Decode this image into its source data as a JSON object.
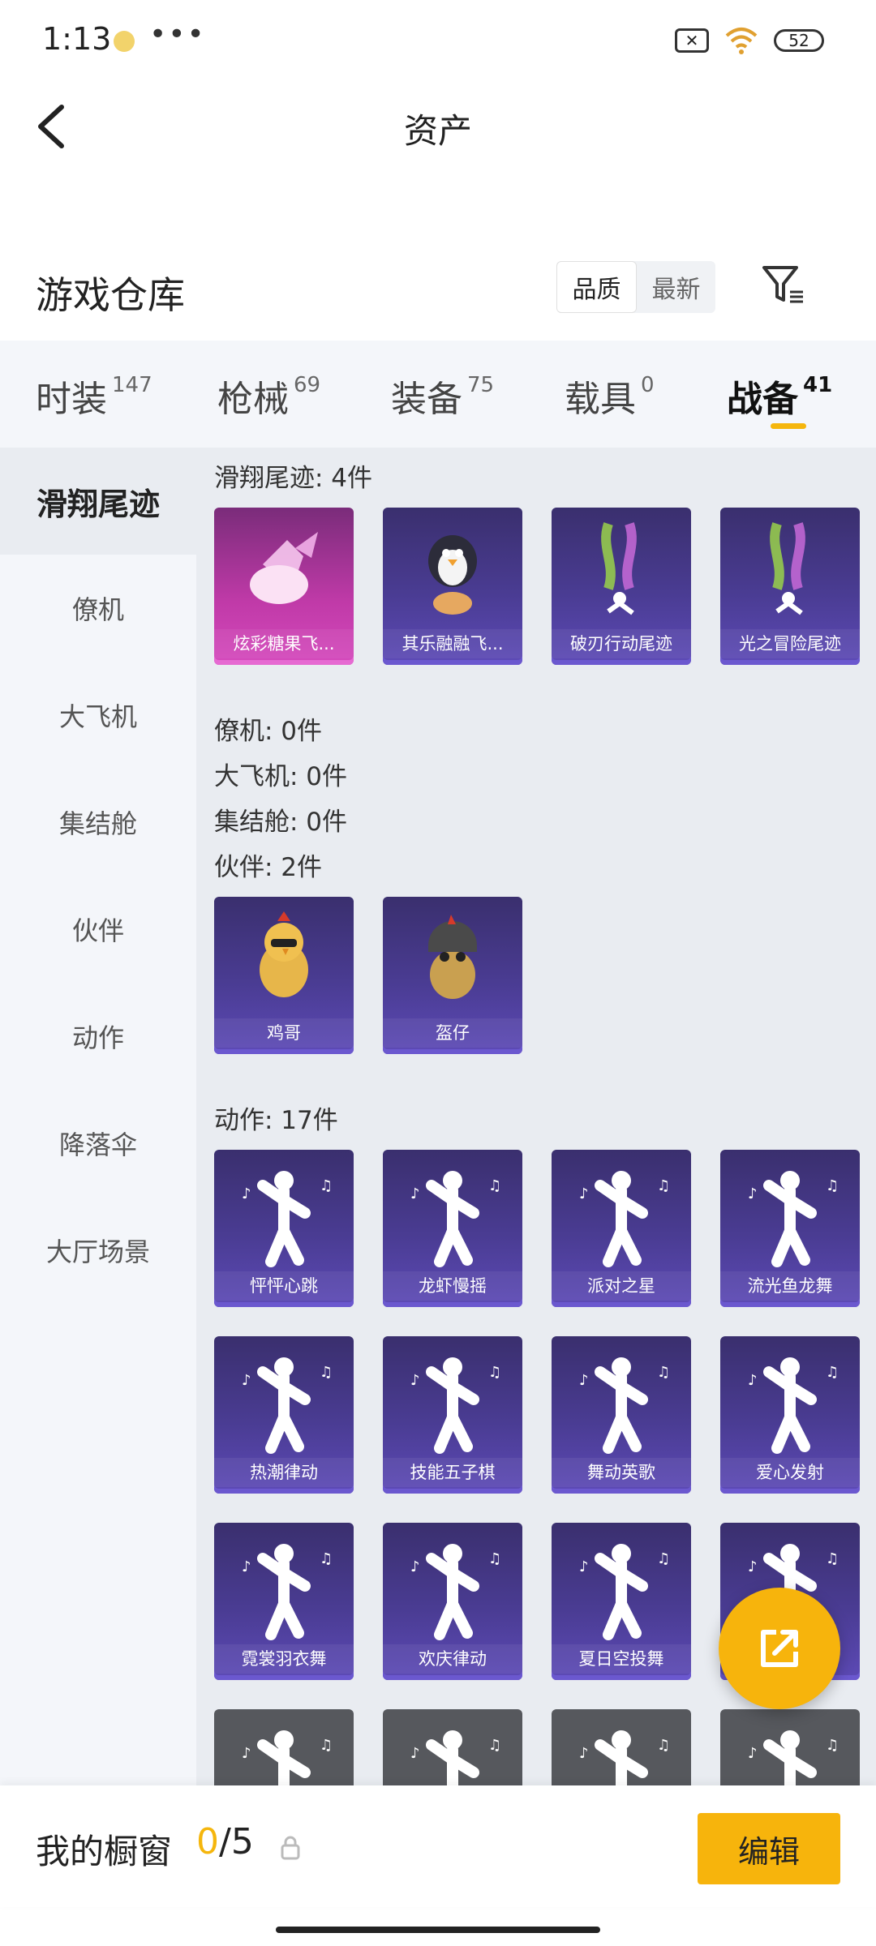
{
  "status_bar": {
    "time": "1:13",
    "dots": "•••",
    "battery": "52"
  },
  "nav": {
    "title": "资产"
  },
  "warehouse": {
    "title": "游戏仓库",
    "sort_options": [
      {
        "label": "品质",
        "active": true
      },
      {
        "label": "最新",
        "active": false
      }
    ]
  },
  "category_tabs": [
    {
      "label": "时装",
      "count": "147"
    },
    {
      "label": "枪械",
      "count": "69"
    },
    {
      "label": "装备",
      "count": "75"
    },
    {
      "label": "载具",
      "count": "0"
    },
    {
      "label": "战备",
      "count": "41",
      "active": true
    }
  ],
  "sidebar": {
    "items": [
      {
        "label": "滑翔尾迹",
        "active": true
      },
      {
        "label": "僚机"
      },
      {
        "label": "大飞机"
      },
      {
        "label": "集结舱"
      },
      {
        "label": "伙伴"
      },
      {
        "label": "动作"
      },
      {
        "label": "降落伞"
      },
      {
        "label": "大厅场景"
      }
    ]
  },
  "groups": [
    {
      "title": "滑翔尾迹: 4件",
      "items": [
        {
          "name": "炫彩糖果飞...",
          "style": "pink",
          "icon": "candy-icon"
        },
        {
          "name": "其乐融融飞...",
          "style": "purple",
          "icon": "penguin-icon"
        },
        {
          "name": "破刃行动尾迹",
          "style": "purple",
          "icon": "smoke-trail-icon"
        },
        {
          "name": "光之冒险尾迹",
          "style": "purple",
          "icon": "smoke-trail-icon"
        }
      ]
    },
    {
      "title": "僚机: 0件",
      "items": []
    },
    {
      "title": "大飞机: 0件",
      "items": []
    },
    {
      "title": "集结舱: 0件",
      "items": []
    },
    {
      "title": "伙伴: 2件",
      "items": [
        {
          "name": "鸡哥",
          "style": "purple",
          "icon": "chicken-icon"
        },
        {
          "name": "盔仔",
          "style": "purple",
          "icon": "helmet-chick-icon"
        }
      ]
    },
    {
      "title": "动作: 17件",
      "items": [
        {
          "name": "怦怦心跳",
          "style": "purple",
          "icon": "dance-figure-icon"
        },
        {
          "name": "龙虾慢摇",
          "style": "purple",
          "icon": "dance-figure-icon"
        },
        {
          "name": "派对之星",
          "style": "purple",
          "icon": "dance-figure-icon"
        },
        {
          "name": "流光鱼龙舞",
          "style": "purple",
          "icon": "dance-figure-icon"
        },
        {
          "name": "热潮律动",
          "style": "purple",
          "icon": "dance-figure-icon"
        },
        {
          "name": "技能五子棋",
          "style": "purple",
          "icon": "dance-figure-icon"
        },
        {
          "name": "舞动英歌",
          "style": "purple",
          "icon": "dance-figure-icon"
        },
        {
          "name": "爱心发射",
          "style": "purple",
          "icon": "dance-figure-icon"
        },
        {
          "name": "霓裳羽衣舞",
          "style": "purple",
          "icon": "dance-figure-icon"
        },
        {
          "name": "欢庆律动",
          "style": "purple",
          "icon": "dance-figure-icon"
        },
        {
          "name": "夏日空投舞",
          "style": "purple",
          "icon": "dance-figure-icon"
        },
        {
          "name": "",
          "style": "purple",
          "icon": "dance-figure-icon"
        },
        {
          "name": "",
          "style": "gray",
          "icon": "dance-figure-icon"
        },
        {
          "name": "",
          "style": "gray",
          "icon": "dance-figure-icon"
        },
        {
          "name": "",
          "style": "gray",
          "icon": "dance-figure-icon"
        },
        {
          "name": "",
          "style": "gray",
          "icon": "dance-figure-icon"
        }
      ]
    }
  ],
  "bottom_bar": {
    "label": "我的橱窗",
    "used": "0",
    "separator": "/",
    "total": "5",
    "edit_label": "编辑"
  },
  "colors": {
    "accent": "#f7b40c",
    "card_purple": "#4a3c93",
    "card_pink": "#c03aa8",
    "panel_bg": "#e9ecf1"
  }
}
